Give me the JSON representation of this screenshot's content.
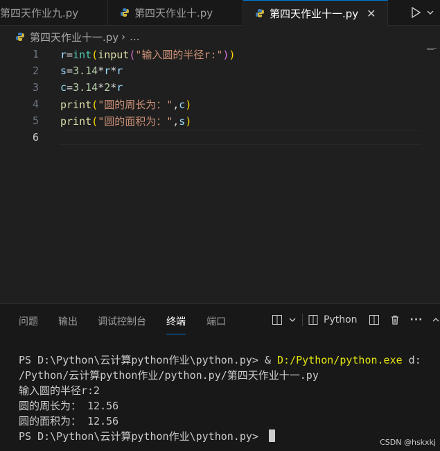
{
  "tabs": [
    {
      "label": "第四天作业九.py"
    },
    {
      "label": "第四天作业十.py"
    },
    {
      "label": "第四天作业十一.py",
      "active": true
    }
  ],
  "icons": {
    "close": "close-icon",
    "run": "run-icon",
    "more": "chevron-down-icon"
  },
  "breadcrumb": {
    "file": "第四天作业十一.py",
    "more": "..."
  },
  "editor": {
    "line_numbers": [
      "1",
      "2",
      "3",
      "4",
      "5",
      "6"
    ]
  },
  "panel": {
    "tabs": [
      "问题",
      "输出",
      "调试控制台",
      "终端",
      "端口"
    ],
    "active_tab": "终端",
    "terminal_profile": "Python"
  },
  "terminal": {
    "line1_prompt": "PS D:\\Python\\云计算python作业\\python.py> ",
    "line1_amp": "& ",
    "line1_exe": "D:/Python/python.exe",
    "line1_arg": " d:",
    "line2": "/Python/云计算python作业/python.py/第四天作业十一.py",
    "line3": "输入圆的半径r:2",
    "line4": "圆的周长为： 12.56",
    "line5": "圆的面积为： 12.56",
    "line6_prompt": "PS D:\\Python\\云计算python作业\\python.py> "
  },
  "watermark": "CSDN @hskxkj",
  "colors": {
    "accent": "#0078d4",
    "background": "#1f1f1f"
  }
}
